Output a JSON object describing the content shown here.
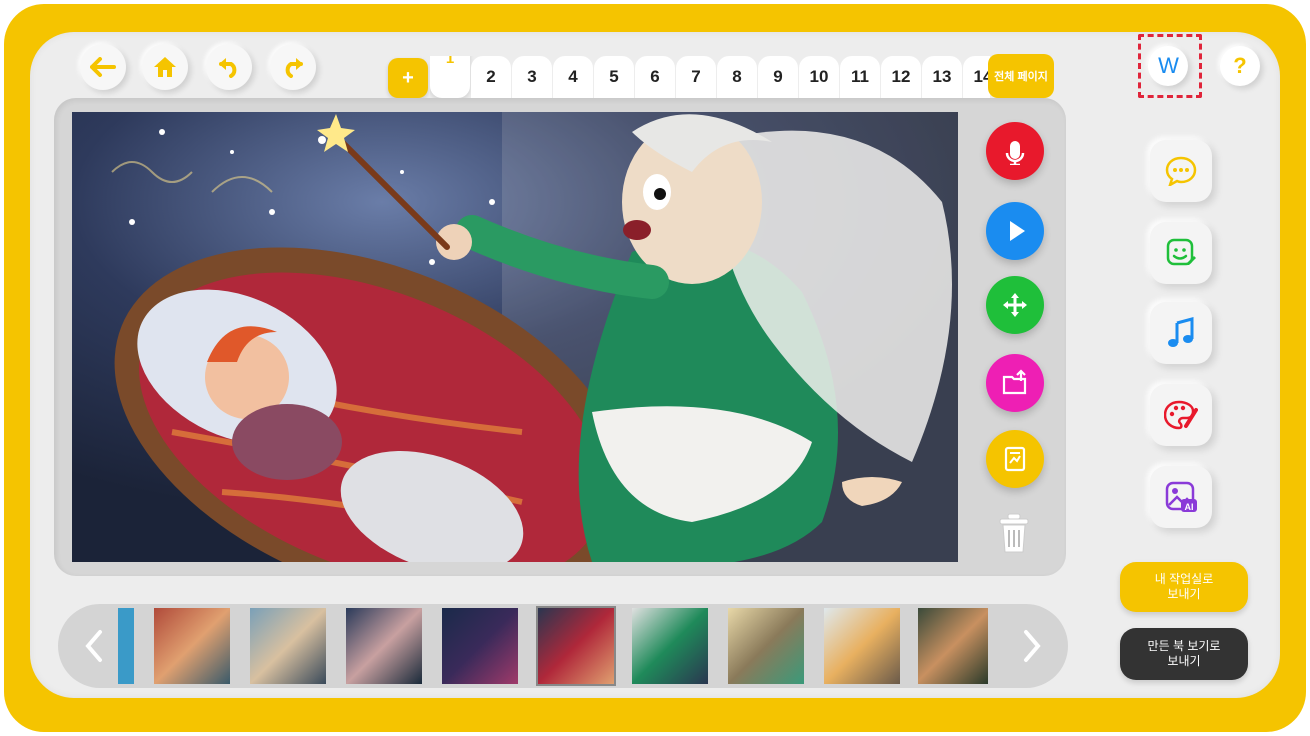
{
  "toolbar": {
    "back_icon": "arrow-left-icon",
    "home_icon": "home-icon",
    "undo_icon": "undo-icon",
    "redo_icon": "redo-icon"
  },
  "pages": {
    "add_label": "+",
    "tabs": [
      "1",
      "2",
      "3",
      "4",
      "5",
      "6",
      "7",
      "8",
      "9",
      "10",
      "11",
      "12",
      "13",
      "14"
    ],
    "active": "1",
    "all_pages_label": "전체 페이지"
  },
  "top_right": {
    "w_label": "W",
    "help_label": "?"
  },
  "tools": [
    {
      "name": "record-button",
      "icon": "microphone-icon",
      "color": "#e8192c"
    },
    {
      "name": "play-button",
      "icon": "play-icon",
      "color": "#1a8cf0"
    },
    {
      "name": "move-button",
      "icon": "move-arrows-icon",
      "color": "#1fbf3a"
    },
    {
      "name": "open-folder-button",
      "icon": "folder-open-icon",
      "color": "#ee1fb4"
    },
    {
      "name": "notebook-button",
      "icon": "notebook-icon",
      "color": "#f5c400"
    }
  ],
  "side_tools": [
    {
      "name": "speech-bubble-button",
      "icon": "speech-bubble-icon"
    },
    {
      "name": "sticker-button",
      "icon": "smiley-edit-icon"
    },
    {
      "name": "music-button",
      "icon": "music-note-icon"
    },
    {
      "name": "paint-button",
      "icon": "palette-icon"
    },
    {
      "name": "ai-image-button",
      "icon": "ai-image-icon"
    }
  ],
  "actions": {
    "send_workroom": "내 작업실로\n보내기",
    "send_book": "만든 북 보기로\n보내기"
  },
  "colors": {
    "frame": "#f5c400",
    "accent": "#f5c400",
    "dark_button": "#333333"
  }
}
